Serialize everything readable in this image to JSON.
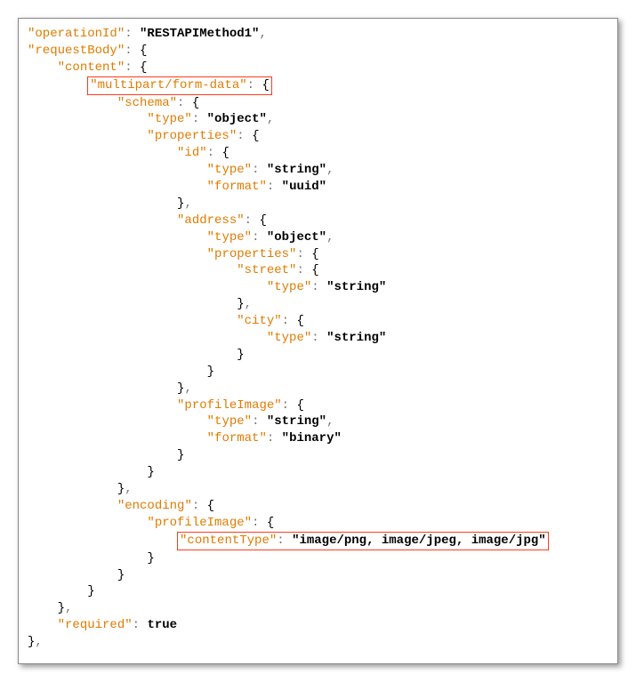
{
  "keys": {
    "operationId": "\"operationId\"",
    "requestBody": "\"requestBody\"",
    "content": "\"content\"",
    "multipart": "\"multipart/form-data\"",
    "schema": "\"schema\"",
    "type": "\"type\"",
    "properties": "\"properties\"",
    "id": "\"id\"",
    "format": "\"format\"",
    "address": "\"address\"",
    "street": "\"street\"",
    "city": "\"city\"",
    "profileImage": "\"profileImage\"",
    "encoding": "\"encoding\"",
    "contentType": "\"contentType\"",
    "required": "\"required\""
  },
  "vals": {
    "operationId": "\"RESTAPIMethod1\"",
    "object": "\"object\"",
    "string": "\"string\"",
    "uuid": "\"uuid\"",
    "binary": "\"binary\"",
    "contentType": "\"image/png, image/jpeg, image/jpg\"",
    "true": "true"
  },
  "punct": {
    "colon": ":",
    "comma": ",",
    "obrace": "{",
    "cbrace": "}"
  }
}
